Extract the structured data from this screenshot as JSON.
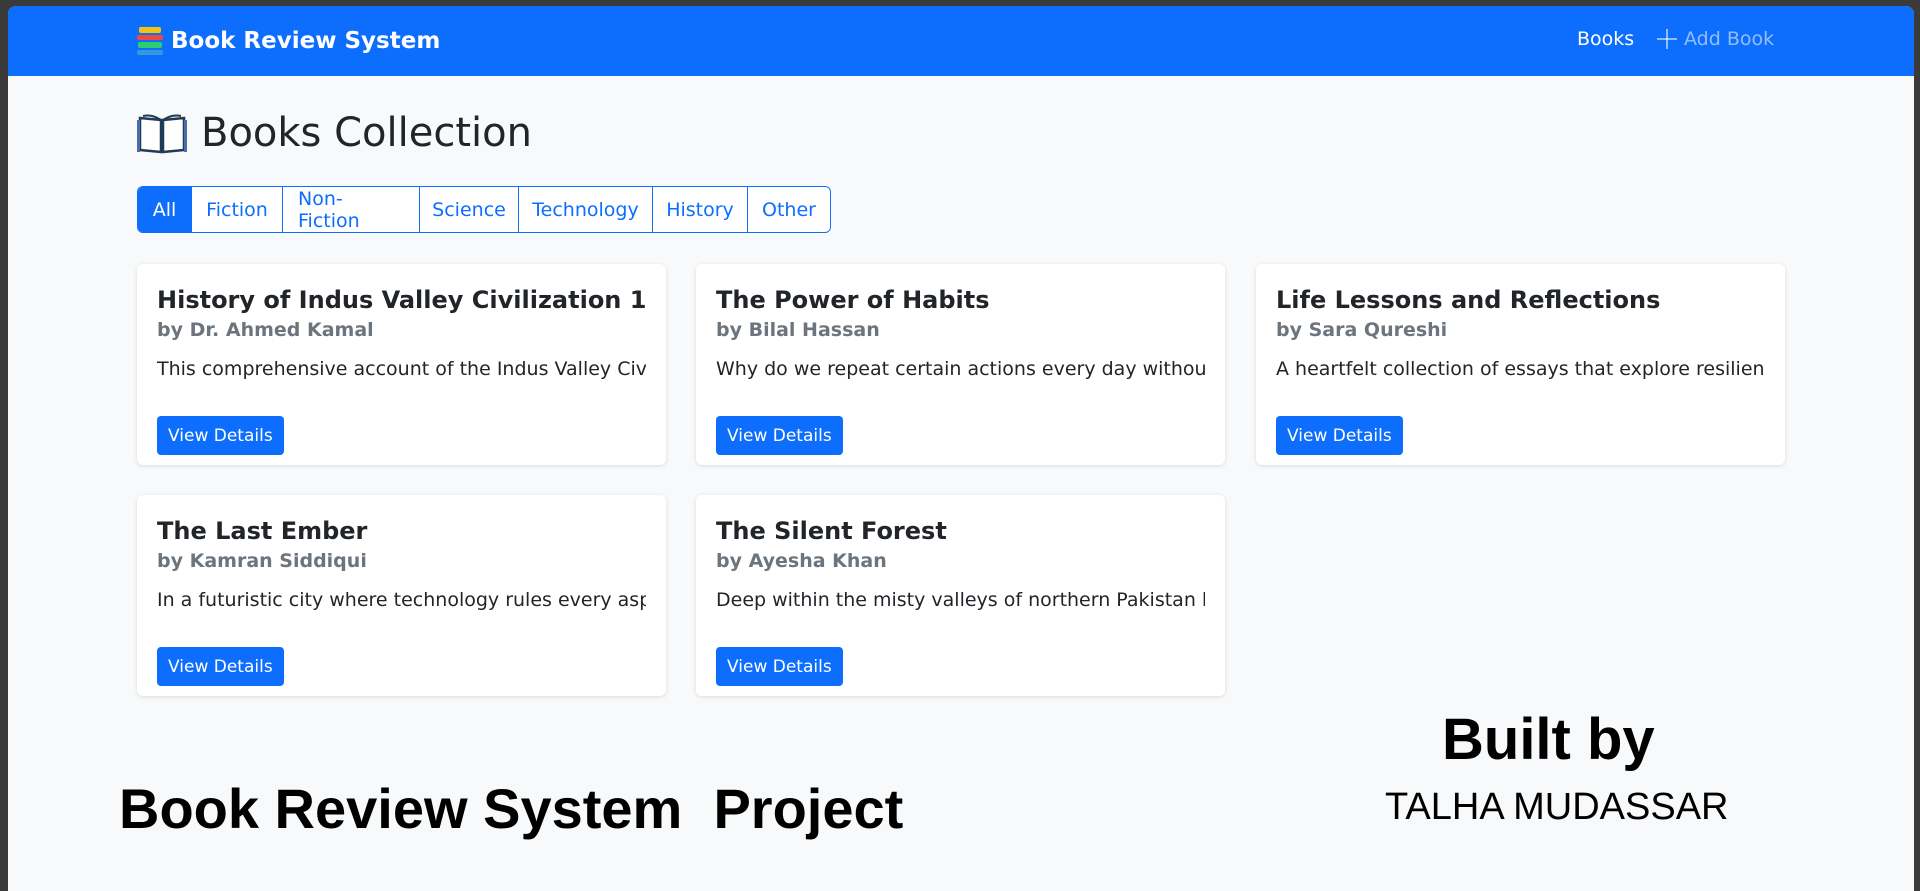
{
  "navbar": {
    "brand": "Book Review System",
    "books_link": "Books",
    "add_book_link": "Add Book"
  },
  "page": {
    "title": "Books Collection"
  },
  "filters": [
    "All",
    "Fiction",
    "Non-Fiction",
    "Science",
    "Technology",
    "History",
    "Other"
  ],
  "active_filter": "All",
  "books": [
    {
      "title": "History of Indus Valley Civilization 1",
      "author": "by Dr. Ahmed Kamal",
      "excerpt": "This comprehensive account of the Indus Valley Civili...",
      "button": "View Details"
    },
    {
      "title": "The Power of Habits",
      "author": "by Bilal Hassan",
      "excerpt": "Why do we repeat certain actions every day without ...",
      "button": "View Details"
    },
    {
      "title": "Life Lessons and Reflections",
      "author": "by Sara Qureshi",
      "excerpt": "A heartfelt collection of essays that explore resilienc...",
      "button": "View Details"
    },
    {
      "title": "The Last Ember",
      "author": "by Kamran Siddiqui",
      "excerpt": "In a futuristic city where technology rules every aspe...",
      "button": "View Details"
    },
    {
      "title": "The Silent Forest",
      "author": "by Ayesha Khan",
      "excerpt": "Deep within the misty valleys of northern Pakistan lie...",
      "button": "View Details"
    }
  ],
  "overlay": {
    "project_label": "Book Review System  Project",
    "built_by": "Built by",
    "author_name": "TALHA MUDASSAR"
  },
  "colors": {
    "primary": "#0d6efd",
    "page_bg": "#f8f9fa",
    "muted": "#6c757d"
  },
  "icons": {
    "brand": "books-stack-icon",
    "title": "open-book-icon",
    "add": "plus-icon"
  }
}
